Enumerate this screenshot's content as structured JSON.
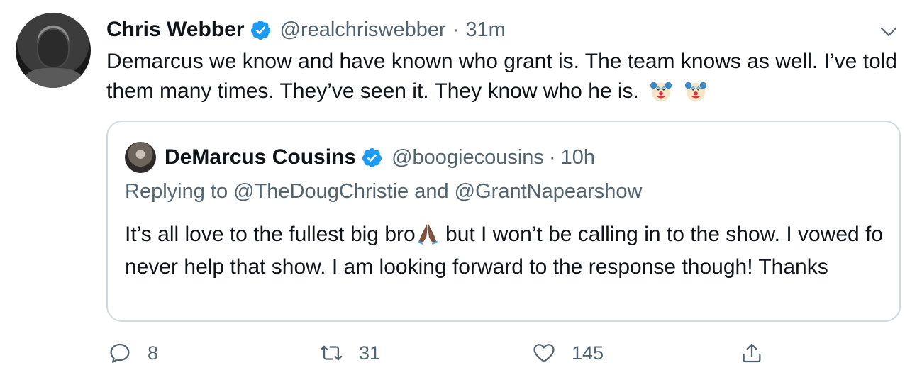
{
  "tweet": {
    "author_name": "Chris Webber",
    "handle": "@realchriswebber",
    "separator": "·",
    "time": "31m",
    "text": "Demarcus we know and have known who grant is. The team knows as well. I’ve told them many times.  They’ve seen it. They know who he is."
  },
  "quoted_tweet": {
    "author_name": "DeMarcus Cousins",
    "handle": "@boogiecousins",
    "separator": "·",
    "time": "10h",
    "replying_to": "Replying to @TheDougChristie and @GrantNapearshow",
    "text_part1": "It’s all love to the fullest big bro",
    "text_part2": " but I won’t be calling in to the show. I vowed fo never help that show. I am looking forward to the response though! Thanks"
  },
  "actions": {
    "reply_count": "8",
    "retweet_count": "31",
    "like_count": "145"
  },
  "icons": {
    "verified": "verified-badge-icon",
    "chevron": "chevron-down-icon",
    "clown": "clown-face-emoji",
    "pray": "folded-hands-emoji",
    "reply": "reply-icon",
    "retweet": "retweet-icon",
    "like": "heart-icon",
    "share": "share-icon"
  },
  "colors": {
    "verified_blue": "#1d9bf0",
    "secondary_text": "#536471",
    "border": "#cfd9de"
  }
}
